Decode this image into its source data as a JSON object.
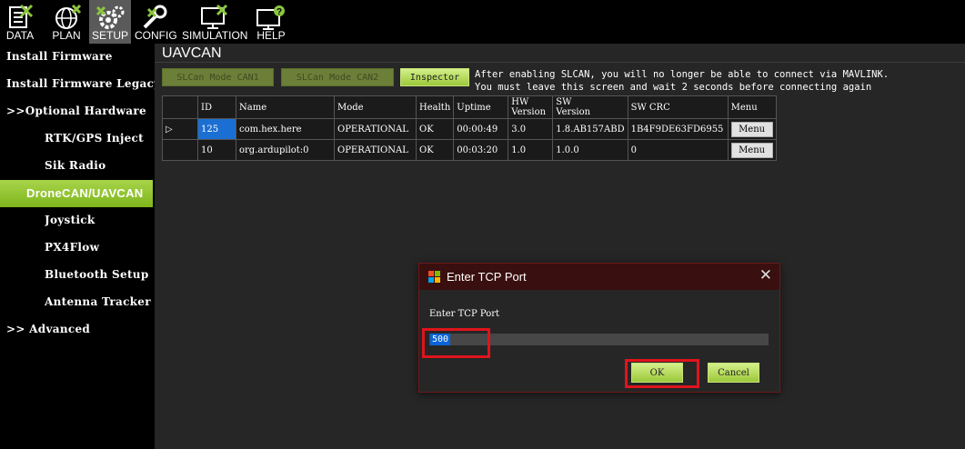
{
  "toolbar": {
    "items": [
      {
        "label": "DATA",
        "icon": "data-icon"
      },
      {
        "label": "PLAN",
        "icon": "globe-icon"
      },
      {
        "label": "SETUP",
        "icon": "gears-icon",
        "active": true
      },
      {
        "label": "CONFIG",
        "icon": "wrench-icon"
      },
      {
        "label": "SIMULATION",
        "icon": "monitor-icon"
      },
      {
        "label": "HELP",
        "icon": "help-monitor-icon"
      }
    ]
  },
  "sidebar": {
    "items": [
      {
        "label": "Install Firmware"
      },
      {
        "label": "Install Firmware Legacy"
      },
      {
        "label": ">>Optional Hardware"
      },
      {
        "label": "RTK/GPS Inject"
      },
      {
        "label": "Sik Radio"
      },
      {
        "label": "DroneCAN/UAVCAN",
        "active": true
      },
      {
        "label": "Joystick"
      },
      {
        "label": "PX4Flow"
      },
      {
        "label": "Bluetooth Setup"
      },
      {
        "label": "Antenna Tracker"
      },
      {
        "label": ">> Advanced"
      }
    ]
  },
  "main": {
    "title": "UAVCAN",
    "buttons": {
      "can1": "SLCan Mode CAN1",
      "can2": "SLCan Mode CAN2",
      "inspector": "Inspector"
    },
    "note_line1": "After enabling SLCAN, you will no longer be able to connect via MAVLINK.",
    "note_line2": "You must leave this screen and wait 2 seconds before connecting again",
    "table": {
      "headers": {
        "id": "ID",
        "name": "Name",
        "mode": "Mode",
        "health": "Health",
        "uptime": "Uptime",
        "hw1": "HW",
        "hw2": "Version",
        "sw1": "SW",
        "sw2": "Version",
        "crc": "SW CRC",
        "menu": "Menu"
      },
      "rows": [
        {
          "marker": "▷",
          "id": "125",
          "name": "com.hex.here",
          "mode": "OPERATIONAL",
          "health": "OK",
          "uptime": "00:00:49",
          "hw": "3.0",
          "sw": "1.8.AB157ABD",
          "crc": "1B4F9DE63FD6955",
          "menu": "Menu"
        },
        {
          "marker": "",
          "id": "10",
          "name": "org.ardupilot:0",
          "mode": "OPERATIONAL",
          "health": "OK",
          "uptime": "00:03:20",
          "hw": "1.0",
          "sw": "1.0.0",
          "crc": "0",
          "menu": "Menu"
        }
      ]
    }
  },
  "dialog": {
    "title": "Enter TCP Port",
    "close": "✕",
    "label": "Enter TCP Port",
    "value": "500",
    "ok": "OK",
    "cancel": "Cancel"
  },
  "colors": {
    "accent_green": "#9cc83a",
    "highlight_red": "#e0141c",
    "selection_blue": "#1b6fd2"
  }
}
